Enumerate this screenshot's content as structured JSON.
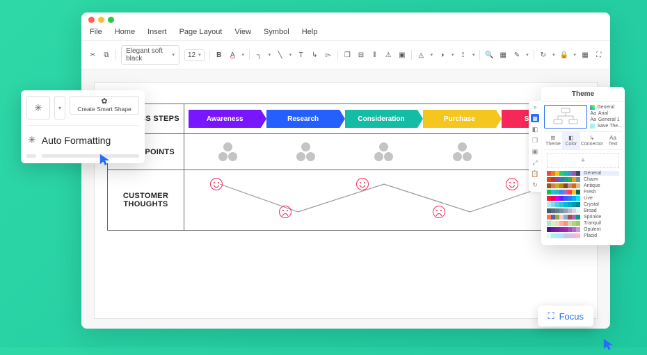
{
  "menubar": [
    "File",
    "Home",
    "Insert",
    "Page Layout",
    "View",
    "Symbol",
    "Help"
  ],
  "toolbar": {
    "font": "Elegant soft black",
    "size": "12"
  },
  "journey": {
    "rows": {
      "process": "PROCESS STEPS",
      "touch": "TOUCHPOINTS",
      "thoughts": "CUSTOMER THOUGHTS"
    },
    "steps": [
      "Awareness",
      "Research",
      "Consideration",
      "Purchase",
      "Support"
    ]
  },
  "popup_left": {
    "create": "Create Smart Shape",
    "auto": "Auto Formatting"
  },
  "theme": {
    "title": "Theme",
    "chips": [
      "General",
      "Arial",
      "General 1",
      "Save The..."
    ],
    "tabs": [
      "Theme",
      "Color",
      "Connector",
      "Text"
    ],
    "palettes": [
      "General",
      "Charm",
      "Antique",
      "Fresh",
      "Live",
      "Crystal",
      "Broad",
      "Sprinkle",
      "Tranquil",
      "Opulent",
      "Placid"
    ]
  },
  "focus": {
    "label": "Focus"
  }
}
